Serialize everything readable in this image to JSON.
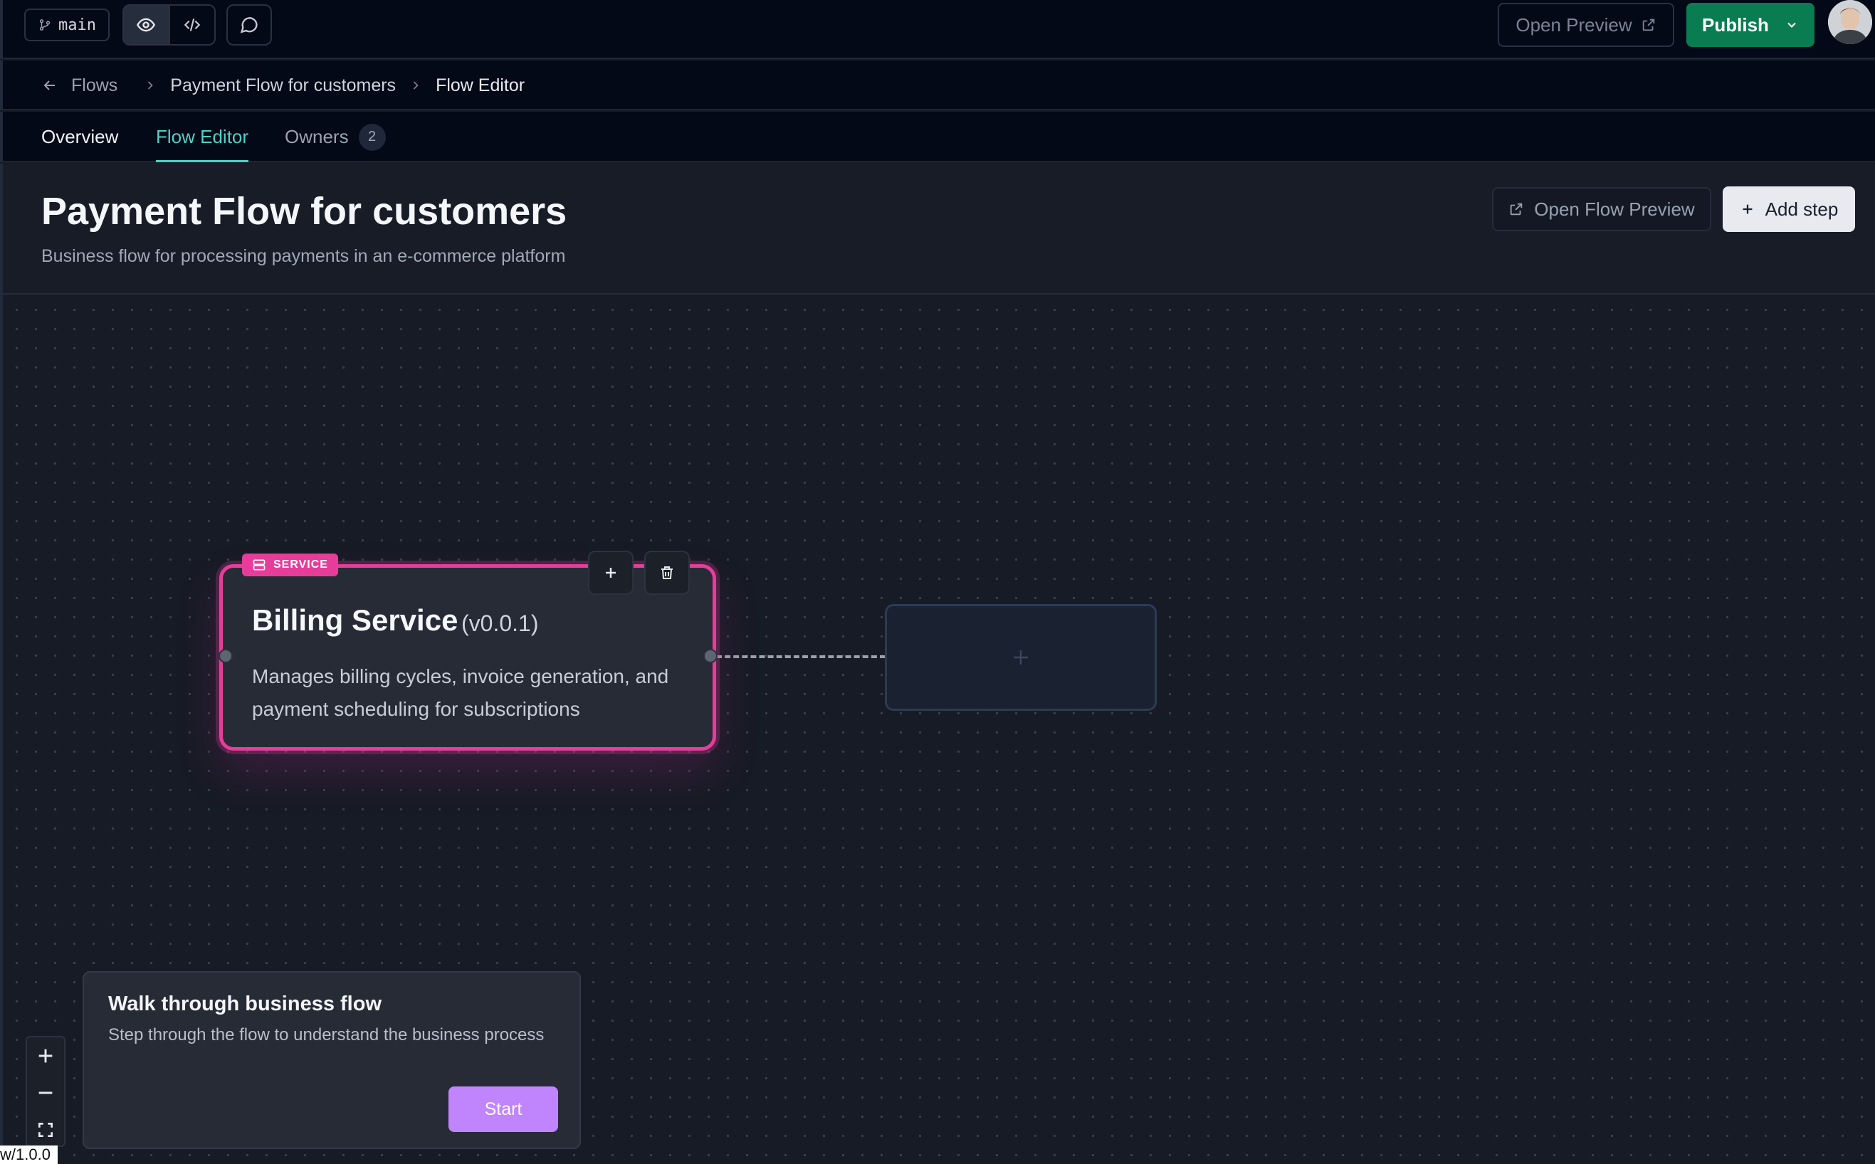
{
  "toolbar": {
    "branch": "main",
    "open_preview": "Open Preview",
    "publish": "Publish"
  },
  "breadcrumb": {
    "flows": "Flows",
    "flow_name": "Payment Flow for customers",
    "current": "Flow Editor"
  },
  "tabs": {
    "overview": "Overview",
    "flow_editor": "Flow Editor",
    "owners": "Owners",
    "owners_count": "2"
  },
  "header": {
    "title": "Payment Flow for customers",
    "subtitle": "Business flow for processing payments in an e-commerce platform",
    "open_flow_preview": "Open Flow Preview",
    "add_step": "Add step"
  },
  "node": {
    "badge": "SERVICE",
    "title": "Billing Service",
    "version": "(v0.0.1)",
    "description": "Manages billing cycles, invoice generation, and payment scheduling for subscriptions"
  },
  "walkthrough": {
    "title": "Walk through business flow",
    "description": "Step through the flow to understand the business process",
    "start": "Start"
  },
  "footer": {
    "version": "w/1.0.0"
  },
  "colors": {
    "accent_green": "#0a7c52",
    "tab_active": "#4fd1c5",
    "service_pink": "#e63d9b",
    "start_purple": "#c084fc"
  }
}
